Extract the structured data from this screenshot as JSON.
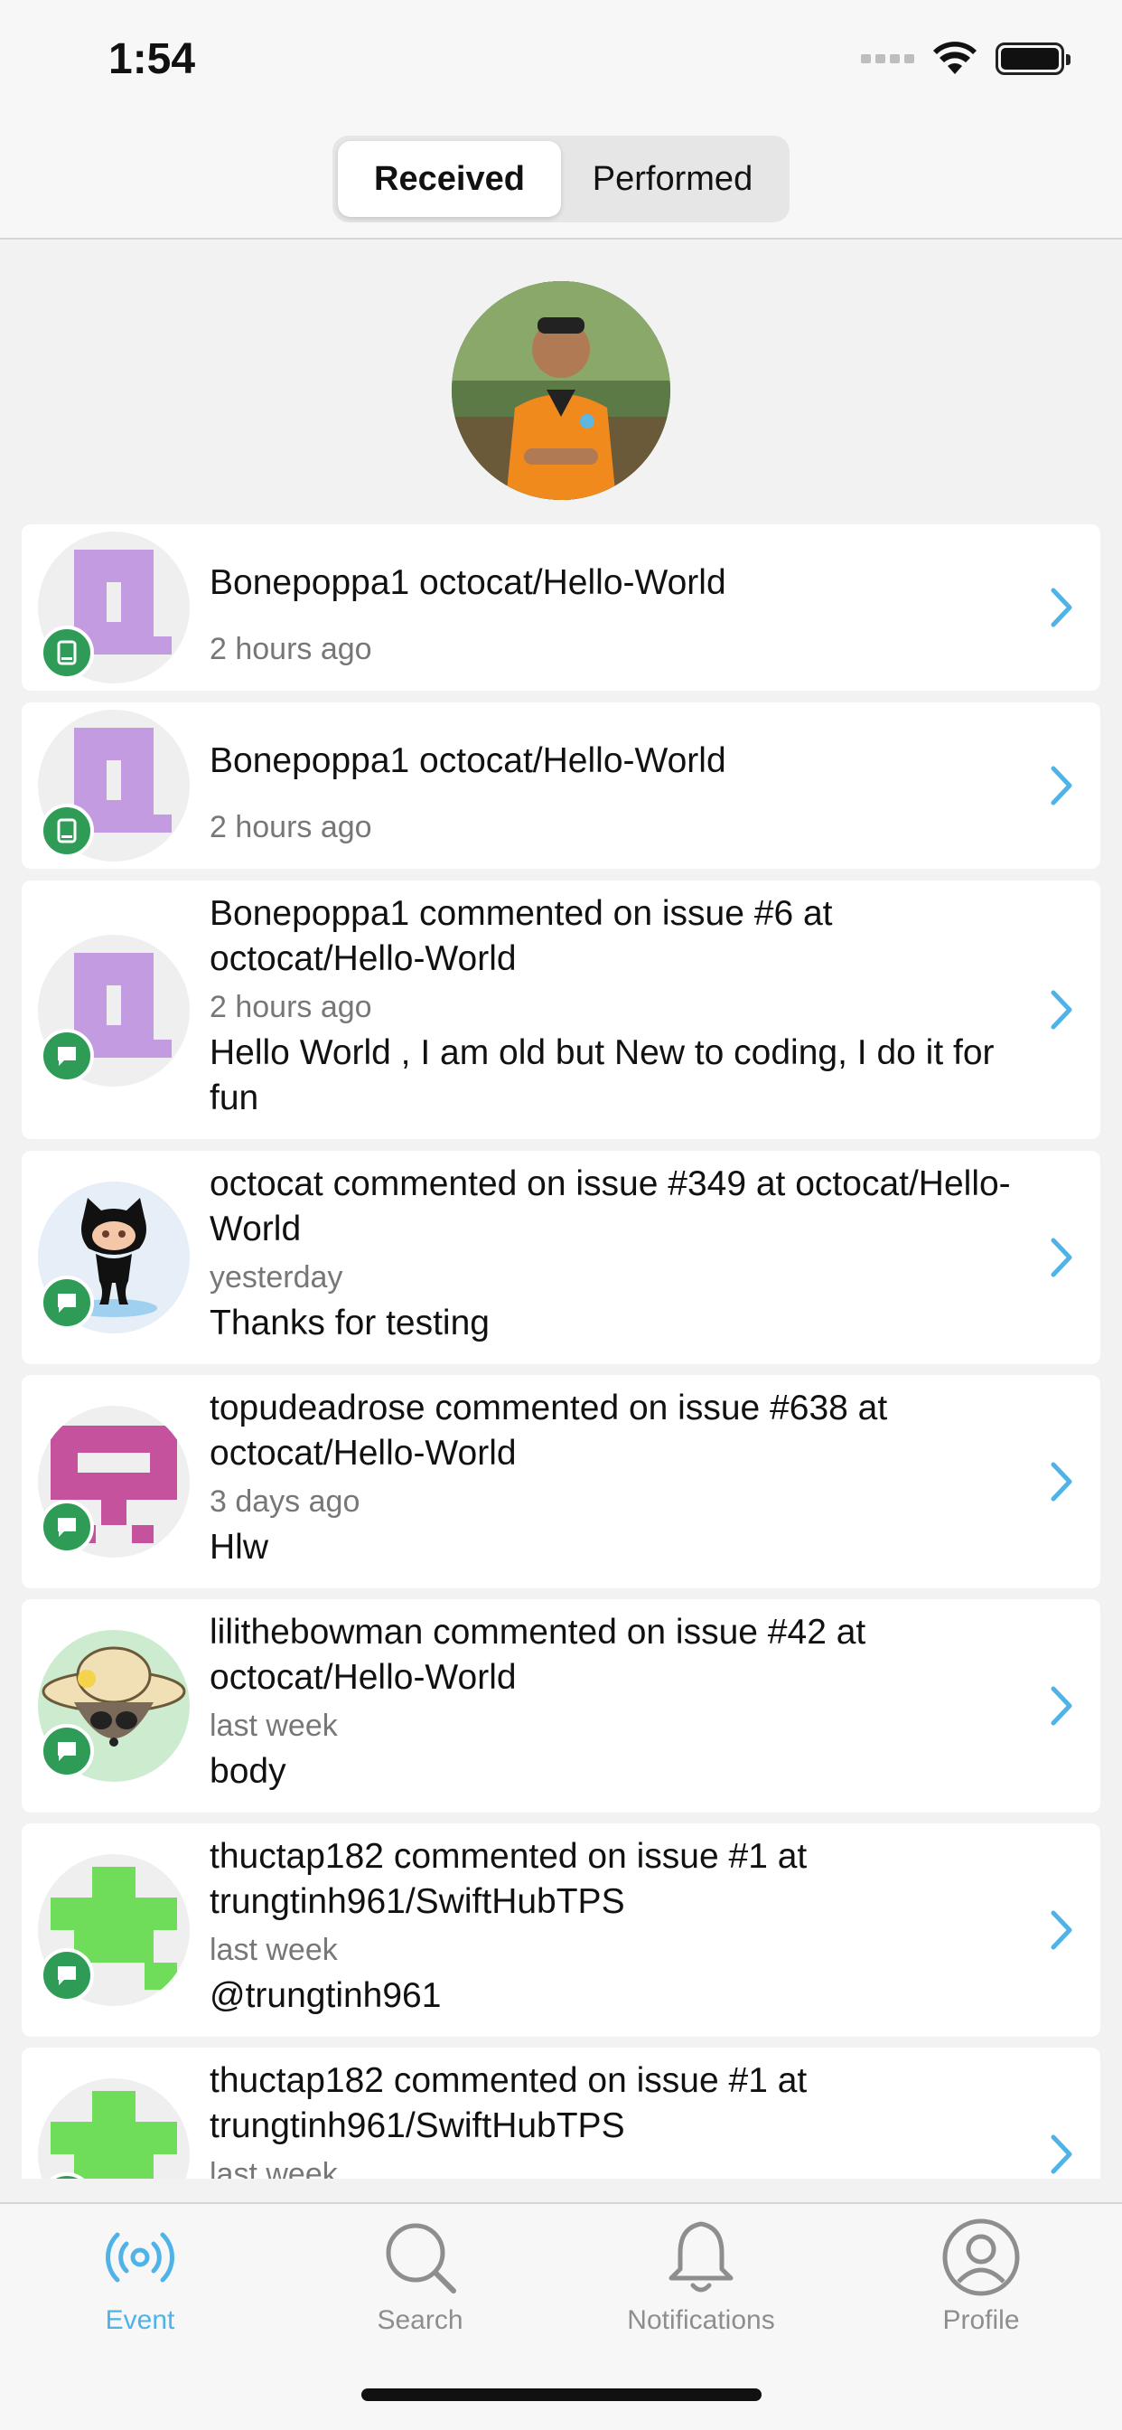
{
  "status_bar": {
    "time": "1:54"
  },
  "segmented_control": {
    "received_label": "Received",
    "performed_label": "Performed",
    "selected": "Received"
  },
  "events": [
    {
      "title": "Bonepoppa1  octocat/Hello-World",
      "time": "2 hours ago",
      "body": "",
      "avatar": "purple-identicon",
      "badge": "device-icon"
    },
    {
      "title": "Bonepoppa1  octocat/Hello-World",
      "time": "2 hours ago",
      "body": "",
      "avatar": "purple-identicon",
      "badge": "device-icon"
    },
    {
      "title": "Bonepoppa1 commented on issue #6 at octocat/Hello-World",
      "time": "2 hours ago",
      "body": "Hello World , I am old but New to coding, I do it for fun",
      "avatar": "purple-identicon",
      "badge": "comment-icon"
    },
    {
      "title": "octocat commented on issue #349 at octocat/Hello-World",
      "time": "yesterday",
      "body": "Thanks for testing",
      "avatar": "octocat-avatar",
      "badge": "comment-icon"
    },
    {
      "title": "topudeadrose commented on issue #638 at octocat/Hello-World",
      "time": "3 days ago",
      "body": "Hlw",
      "avatar": "pink-identicon",
      "badge": "comment-icon"
    },
    {
      "title": "lilithebowman commented on issue #42 at octocat/Hello-World",
      "time": "last week",
      "body": "body",
      "avatar": "raccoon-hat-avatar",
      "badge": "comment-icon"
    },
    {
      "title": "thuctap182 commented on issue #1 at trungtinh961/SwiftHubTPS",
      "time": "last week",
      "body": "@trungtinh961",
      "avatar": "green-identicon",
      "badge": "comment-icon"
    },
    {
      "title": "thuctap182 commented on issue #1 at trungtinh961/SwiftHubTPS",
      "time": "last week",
      "body": "",
      "avatar": "green-identicon",
      "badge": "comment-icon"
    }
  ],
  "tab_bar": {
    "tabs": [
      {
        "label": "Event",
        "icon": "broadcast-icon",
        "active": true
      },
      {
        "label": "Search",
        "icon": "search-icon",
        "active": false
      },
      {
        "label": "Notifications",
        "icon": "bell-icon",
        "active": false
      },
      {
        "label": "Profile",
        "icon": "person-circle-icon",
        "active": false
      }
    ]
  },
  "colors": {
    "accent": "#4fb3e8",
    "badge_green": "#2e9b57",
    "purple_identicon": "#c39be0",
    "pink_identicon": "#c4529c",
    "green_identicon": "#6fdc5a"
  }
}
